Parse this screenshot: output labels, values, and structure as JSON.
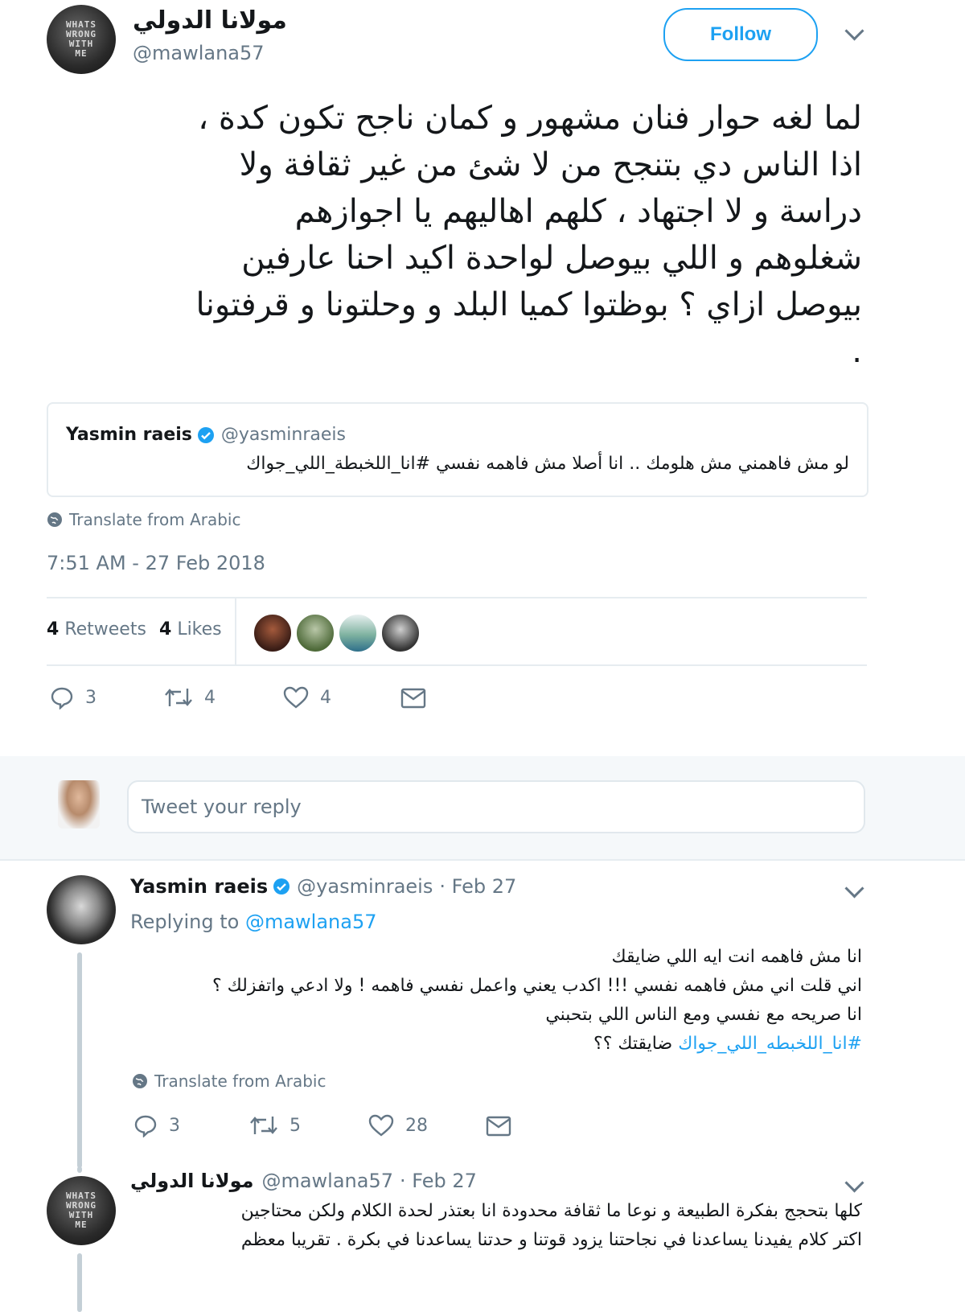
{
  "main_tweet": {
    "author_name": "مولانا الدولي",
    "author_handle": "@mawlana57",
    "avatar_text": "WHATS\nWRONG\nWITH\nME",
    "follow_label": "Follow",
    "text_lines": [
      "لما لغه حوار فنان مشهور و كمان ناجح تكون كدة ،",
      "اذا الناس دي بتنجح من لا شئ من غير ثقافة ولا",
      "دراسة و لا اجتهاد ، كلهم اهاليهم يا اجوازهم",
      "شغلوهم و اللي بيوصل لواحدة اكيد احنا عارفين",
      "بيوصل ازاي ؟ بوظتوا كميا البلد و وحلتونا و قرفتونا",
      "."
    ],
    "quoted": {
      "name": "Yasmin raeis",
      "handle": "@yasminraeis",
      "text": "لو مش فاهمني مش هلومك .. انا أصلا مش فاهمه نفسي #انا_اللخبطة_اللي_جواك"
    },
    "translate_label": "Translate from Arabic",
    "timestamp": "7:51 AM - 27 Feb 2018",
    "stats": {
      "retweets_count": "4",
      "retweets_label": "Retweets",
      "likes_count": "4",
      "likes_label": "Likes"
    },
    "actions": {
      "replies": "3",
      "retweets": "4",
      "likes": "4"
    }
  },
  "reply_box": {
    "placeholder": "Tweet your reply"
  },
  "replies": [
    {
      "author_name": "Yasmin raeis",
      "author_handle": "@yasminraeis",
      "date": "· Feb 27",
      "replying_prefix": "Replying to",
      "replying_handle": "@mawlana57",
      "lines": [
        "انا مش فاهمه انت ايه اللي ضايقك",
        "اني قلت اني مش فاهمه نفسي !!! اكدب يعني واعمل نفسي فاهمه ! ولا ادعي واتفزلك ؟",
        "انا صريحه مع نفسي ومع الناس اللي بتحبني"
      ],
      "last_line_hashtag": "#انا_اللخبطه_اللي_جواك",
      "last_line_rest": "ضايقتك ؟؟",
      "translate_label": "Translate from Arabic",
      "actions": {
        "replies": "3",
        "retweets": "5",
        "likes": "28"
      }
    },
    {
      "author_name": "مولانا الدولي",
      "author_handle": "@mawlana57",
      "date": "· Feb 27",
      "lines": [
        "كلها بتحجج بفكرة الطبيعة و نوعا ما ثقافة محدودة انا بعتذر لحدة الكلام ولكن محتاجين",
        "اكتر كلام يفيدنا يساعدنا في نجاحتنا يزود قوتنا و حدتنا يساعدنا في بكرة . تقريبا معظم"
      ]
    }
  ],
  "colors": {
    "accent": "#1da1f2",
    "muted": "#657786",
    "border": "#e6ecf0"
  }
}
